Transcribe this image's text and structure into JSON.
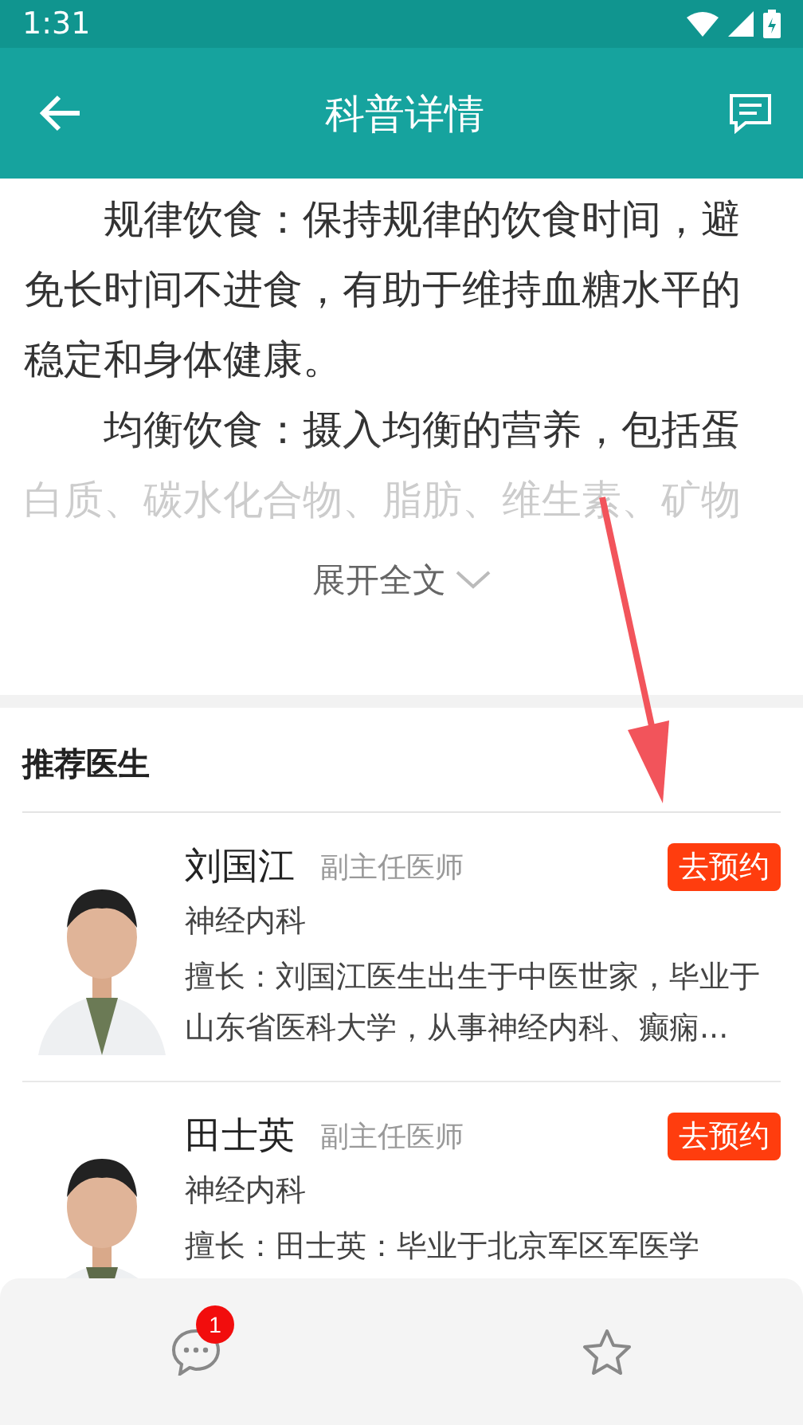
{
  "status_bar": {
    "time": "1:31"
  },
  "header": {
    "title": "科普详情"
  },
  "article": {
    "paragraphs": [
      "规律饮食：保持规律的饮食时间，避免长时间不进食，有助于维持血糖水平的稳定和身体健康。",
      "均衡饮食：摄入均衡的营养，包括蛋白质、碳水化合物、脂肪、维生素、矿物"
    ],
    "expand_label": "展开全文"
  },
  "recommend": {
    "title": "推荐医生",
    "doctors": [
      {
        "name": "刘国江",
        "rank": "副主任医师",
        "department": "神经内科",
        "specialty": "擅长：刘国江医生出生于中医世家，毕业于山东省医科大学，从事神经内科、癫痫...",
        "button": "去预约"
      },
      {
        "name": "田士英",
        "rank": "副主任医师",
        "department": "神经内科",
        "specialty": "擅长：田士英：毕业于北京军区军医学",
        "button": "去预约"
      }
    ]
  },
  "bottom_bar": {
    "message_badge": "1"
  }
}
